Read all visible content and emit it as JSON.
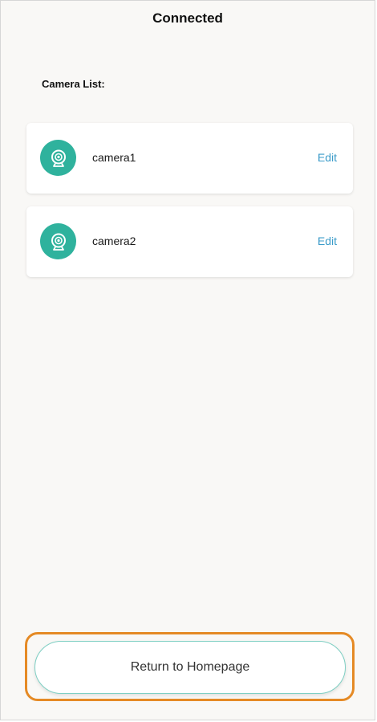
{
  "header": {
    "title": "Connected"
  },
  "camera_list": {
    "label": "Camera List:",
    "items": [
      {
        "name": "camera1",
        "action_label": "Edit",
        "icon": "webcam-icon"
      },
      {
        "name": "camera2",
        "action_label": "Edit",
        "icon": "webcam-icon"
      }
    ]
  },
  "footer": {
    "return_label": "Return to Homepage"
  },
  "colors": {
    "accent_teal": "#2fb29d",
    "link_blue": "#3a9bc9",
    "highlight_orange": "#e58a25",
    "button_border": "#7ecfc3",
    "background": "#f9f8f6"
  }
}
